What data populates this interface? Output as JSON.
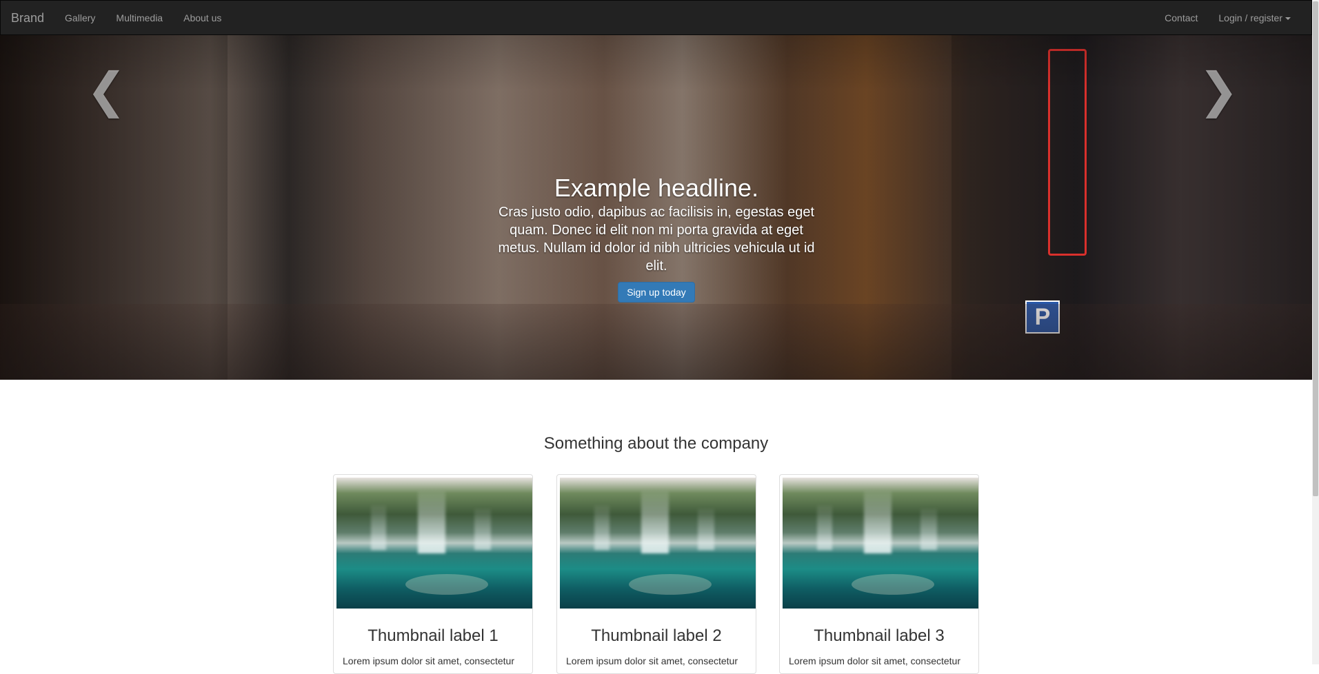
{
  "navbar": {
    "brand": "Brand",
    "left_links": [
      "Gallery",
      "Multimedia",
      "About us"
    ],
    "right_links": {
      "contact": "Contact",
      "login": "Login / register"
    }
  },
  "hero": {
    "headline": "Example headline.",
    "text": "Cras justo odio, dapibus ac facilisis in, egestas eget quam. Donec id elit non mi porta gravida at eget metus. Nullam id dolor id nibh ultricies vehicula ut id elit.",
    "cta": "Sign up today",
    "prev_glyph": "❮",
    "next_glyph": "❯"
  },
  "company": {
    "title": "Something about the company"
  },
  "thumbnails": [
    {
      "label": "Thumbnail label 1",
      "text": "Lorem ipsum dolor sit amet, consectetur"
    },
    {
      "label": "Thumbnail label 2",
      "text": "Lorem ipsum dolor sit amet, consectetur"
    },
    {
      "label": "Thumbnail label 3",
      "text": "Lorem ipsum dolor sit amet, consectetur"
    }
  ],
  "colors": {
    "navbar_bg": "#222222",
    "nav_text": "#9d9d9d",
    "primary_button": "#337ab7"
  }
}
